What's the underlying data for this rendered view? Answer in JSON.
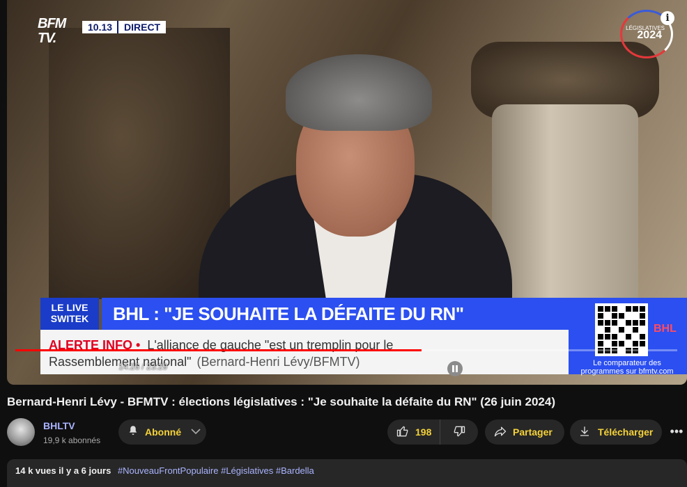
{
  "player": {
    "channel_logo": "BFM TV.",
    "clock": "10.13",
    "live_label": "DIRECT",
    "elections_logo_text": "LÉGISLATIVES",
    "elections_logo_year": "2024",
    "info_icon": "i",
    "banner_tag": "LE LIVE SWITEK",
    "banner_title": "BHL : \"JE SOUHAITE LA DÉFAITE DU RN\"",
    "alert_label": "ALERTE INFO •",
    "alert_text_1": "L'alliance de gauche \"est un tremplin pour le",
    "alert_text_2": "Rassemblement national\"",
    "alert_credit": "(Bernard-Henri Lévy/BFMTV)",
    "qr_brand": "BHL",
    "qr_caption": "Le comparateur des programmes sur bfmtv.com",
    "timecode": "14:26 / 23:29",
    "progress_fraction": 0.614
  },
  "video": {
    "title": "Bernard-Henri Lévy - BFMTV : élections législatives : \"Je souhaite la défaite du RN\" (26 juin 2024)"
  },
  "channel": {
    "name": "BHLTV",
    "subscribers": "19,9 k abonnés"
  },
  "actions": {
    "subscribed_label": "Abonné",
    "like_count": "198",
    "share_label": "Partager",
    "download_label": "Télécharger"
  },
  "description": {
    "meta": "14 k vues  il y a 6 jours",
    "hashtags": "#NouveauFrontPopulaire #Législatives #Bardella"
  },
  "icons": {
    "bell": "bell-icon",
    "like": "thumbs-up-icon",
    "dislike": "thumbs-down-icon",
    "share": "share-arrow-icon",
    "download": "download-icon",
    "more": "more-horizontal-icon"
  },
  "colors": {
    "progress": "#ff0000",
    "banner_blue": "#2b4ff0",
    "alert_red": "#e00020",
    "hashtag": "#aab4ff"
  }
}
